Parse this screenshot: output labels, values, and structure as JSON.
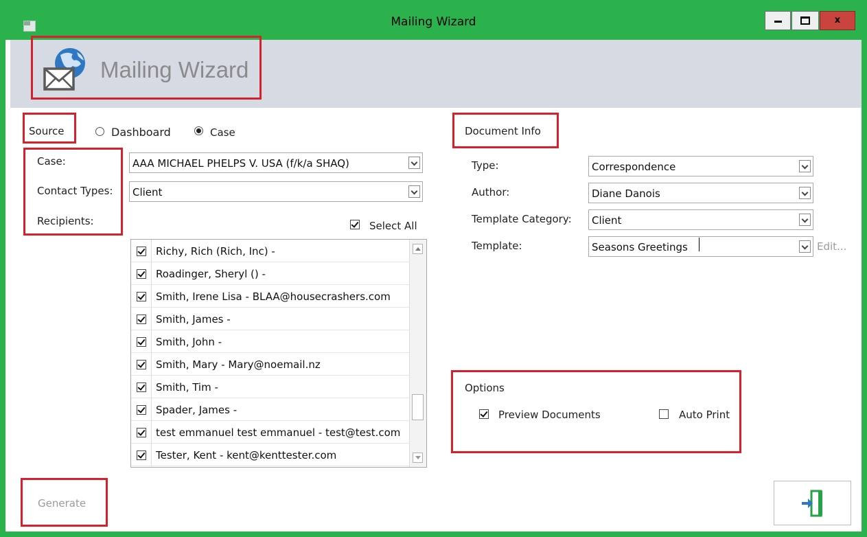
{
  "window": {
    "title": "Mailing Wizard",
    "buttons": {
      "minimize": "minimize",
      "maximize": "maximize",
      "close": "x"
    }
  },
  "header": {
    "title": "Mailing Wizard",
    "logo_icon": "mail-globe-icon"
  },
  "source": {
    "label": "Source",
    "options": [
      {
        "label": "Dashboard",
        "selected": false
      },
      {
        "label": "Case",
        "selected": true
      }
    ]
  },
  "left_form": {
    "case_label": "Case:",
    "case_value": "AAA MICHAEL PHELPS V. USA  (f/k/a SHAQ)",
    "contact_types_label": "Contact Types:",
    "contact_types_value": "Client",
    "recipients_label": "Recipients:",
    "select_all_label": "Select All",
    "select_all_checked": true
  },
  "recipients": [
    {
      "text": "Richy, Rich (Rich, Inc) -",
      "checked": true
    },
    {
      "text": "Roadinger, Sheryl () -",
      "checked": true
    },
    {
      "text": "Smith, Irene Lisa - BLAA@housecrashers.com",
      "checked": true
    },
    {
      "text": "Smith, James -",
      "checked": true
    },
    {
      "text": "Smith, John -",
      "checked": true
    },
    {
      "text": "Smith, Mary - Mary@noemail.nz",
      "checked": true
    },
    {
      "text": "Smith, Tim -",
      "checked": true
    },
    {
      "text": "Spader, James -",
      "checked": true
    },
    {
      "text": "test emmanuel test emmanuel - test@test.com",
      "checked": true
    },
    {
      "text": "Tester, Kent - kent@kenttester.com",
      "checked": true
    }
  ],
  "document_info": {
    "heading": "Document Info",
    "type_label": "Type:",
    "type_value": "Correspondence",
    "author_label": "Author:",
    "author_value": "Diane Danois",
    "template_category_label": "Template Category:",
    "template_category_value": "Client",
    "template_label": "Template:",
    "template_value": "Seasons Greetings",
    "edit_link": "Edit..."
  },
  "options": {
    "heading": "Options",
    "preview_label": "Preview Documents",
    "preview_checked": true,
    "autoprint_label": "Auto Print",
    "autoprint_checked": false
  },
  "footer": {
    "generate_label": "Generate",
    "exit_icon": "exit-door-icon"
  },
  "colors": {
    "window_frame": "#2bb24c",
    "banner": "#d5dae3",
    "highlight_box": "#d6202b",
    "close_button": "#c9443c"
  }
}
